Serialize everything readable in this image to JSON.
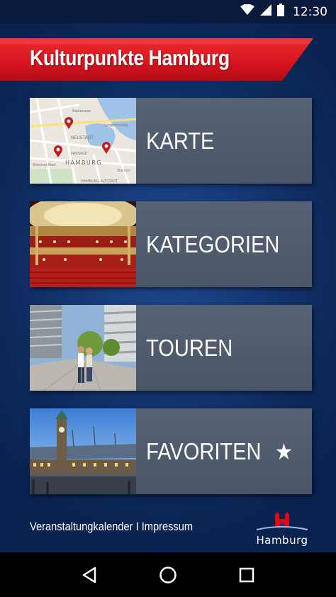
{
  "status_bar": {
    "time": "12:30"
  },
  "header": {
    "title": "Kulturpunkte Hamburg"
  },
  "menu": [
    {
      "label": "KARTE",
      "thumb": "map"
    },
    {
      "label": "KATEGORIEN",
      "thumb": "theater"
    },
    {
      "label": "TOUREN",
      "thumb": "street"
    },
    {
      "label": "FAVORITEN",
      "thumb": "harbor",
      "icon": "star-icon"
    }
  ],
  "map_labels": {
    "neustadt": "NEUSTADT",
    "passage": "PASSAGE",
    "hamburg": "HAMBURG",
    "altstadt": "HAMBURG-ALTSTADT",
    "esplanade": "Esplanade",
    "lombardsbrucke": "Lombardsbrücke",
    "jungfernstieg": "Jungfernstieg",
    "steinstr": "Steinstr",
    "bleichenfleet": "Bleichenfleet"
  },
  "footer": {
    "calendar": "Veranstaltungkalender",
    "separator": "I",
    "impressum": "Impressum",
    "logo_text": "Hamburg"
  },
  "colors": {
    "banner_red": "#d4141e",
    "card_bg": "#4f5a6c",
    "logo_red": "#e30613"
  }
}
